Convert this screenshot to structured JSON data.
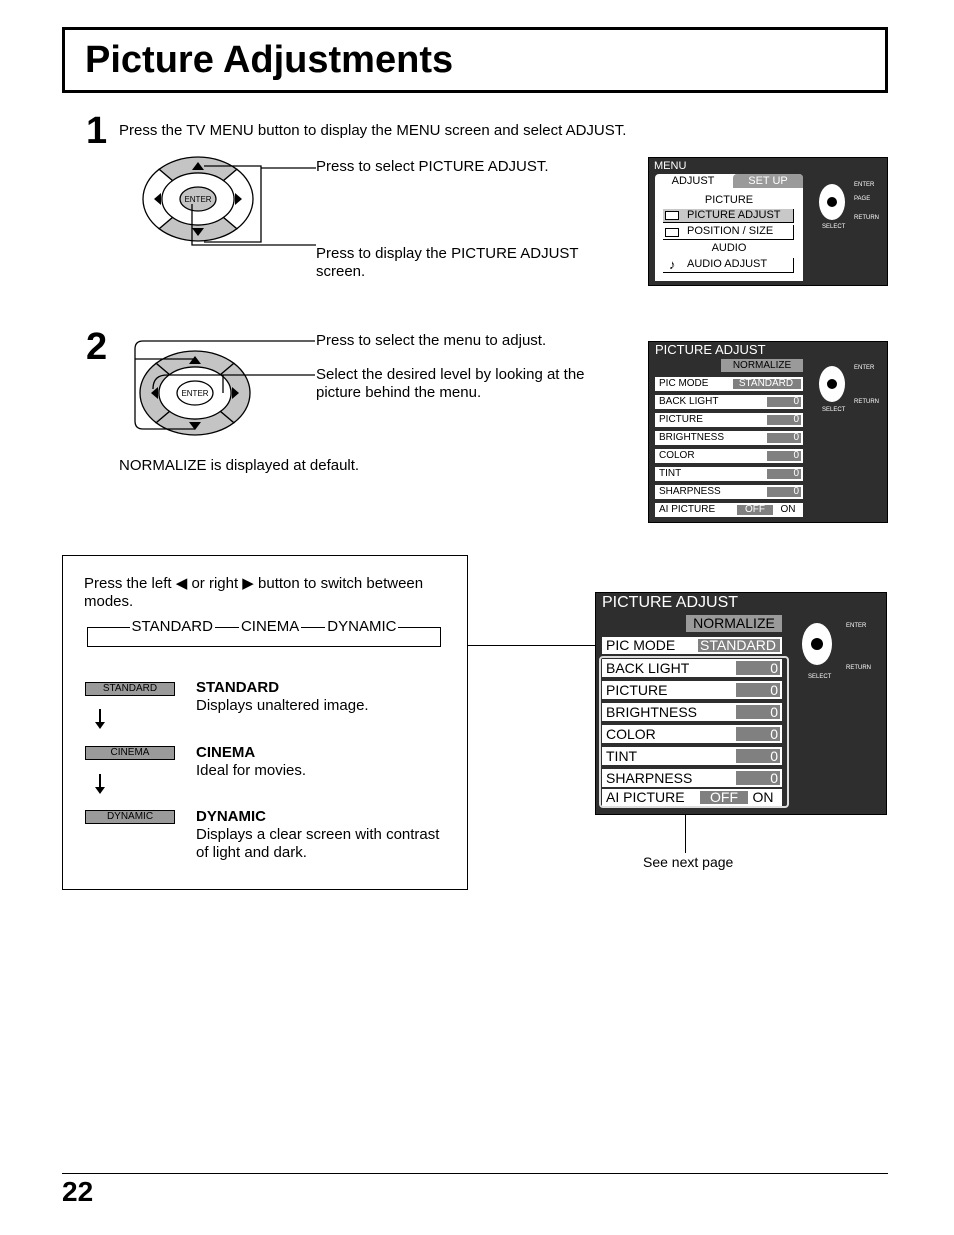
{
  "title": "Picture Adjustments",
  "step1": {
    "number": "1",
    "text": "Press the TV MENU button to display the MENU screen and select ADJUST.",
    "callout_select": "Press to select PICTURE ADJUST.",
    "callout_display": "Press to display the PICTURE ADJUST screen.",
    "enter_label": "ENTER"
  },
  "menu_screen": {
    "title": "MENU",
    "tab_adjust": "ADJUST",
    "tab_setup": "SET  UP",
    "section_picture": "PICTURE",
    "item_picture_adjust": "PICTURE  ADJUST",
    "item_position_size": "POSITION / SIZE",
    "section_audio": "AUDIO",
    "item_audio_adjust": "AUDIO  ADJUST",
    "nav_enter": "ENTER",
    "nav_page": "PAGE",
    "nav_return": "RETURN",
    "nav_select": "SELECT"
  },
  "step2": {
    "number": "2",
    "callout_select": "Press to select the menu to adjust.",
    "callout_level": "Select the desired level by looking at the picture behind the menu.",
    "normalize_note": "NORMALIZE is displayed at default.",
    "enter_label": "ENTER"
  },
  "picture_adjust": {
    "title": "PICTURE ADJUST",
    "normalize": "NORMALIZE",
    "pic_mode_label": "PIC  MODE",
    "pic_mode_value": "STANDARD",
    "rows": [
      {
        "label": "BACK  LIGHT",
        "value": "0"
      },
      {
        "label": "PICTURE",
        "value": "0"
      },
      {
        "label": "BRIGHTNESS",
        "value": "0"
      },
      {
        "label": "COLOR",
        "value": "0"
      },
      {
        "label": "TINT",
        "value": "0"
      },
      {
        "label": "SHARPNESS",
        "value": "0"
      }
    ],
    "ai_label": "AI  PICTURE",
    "ai_off": "OFF",
    "ai_on": "ON",
    "nav_enter": "ENTER",
    "nav_return": "RETURN",
    "nav_select": "SELECT"
  },
  "modes_box": {
    "instruction_pre": "Press the left",
    "instruction_mid": "or right",
    "instruction_post": "button to switch between modes.",
    "cycle": [
      "STANDARD",
      "CINEMA",
      "DYNAMIC"
    ],
    "modes": [
      {
        "badge": "STANDARD",
        "name": "STANDARD",
        "desc": "Displays unaltered image."
      },
      {
        "badge": "CINEMA",
        "name": "CINEMA",
        "desc": "Ideal for movies."
      },
      {
        "badge": "DYNAMIC",
        "name": "DYNAMIC",
        "desc": "Displays a clear screen with contrast of light and dark."
      }
    ]
  },
  "see_next_page": "See next page",
  "page_number": "22"
}
